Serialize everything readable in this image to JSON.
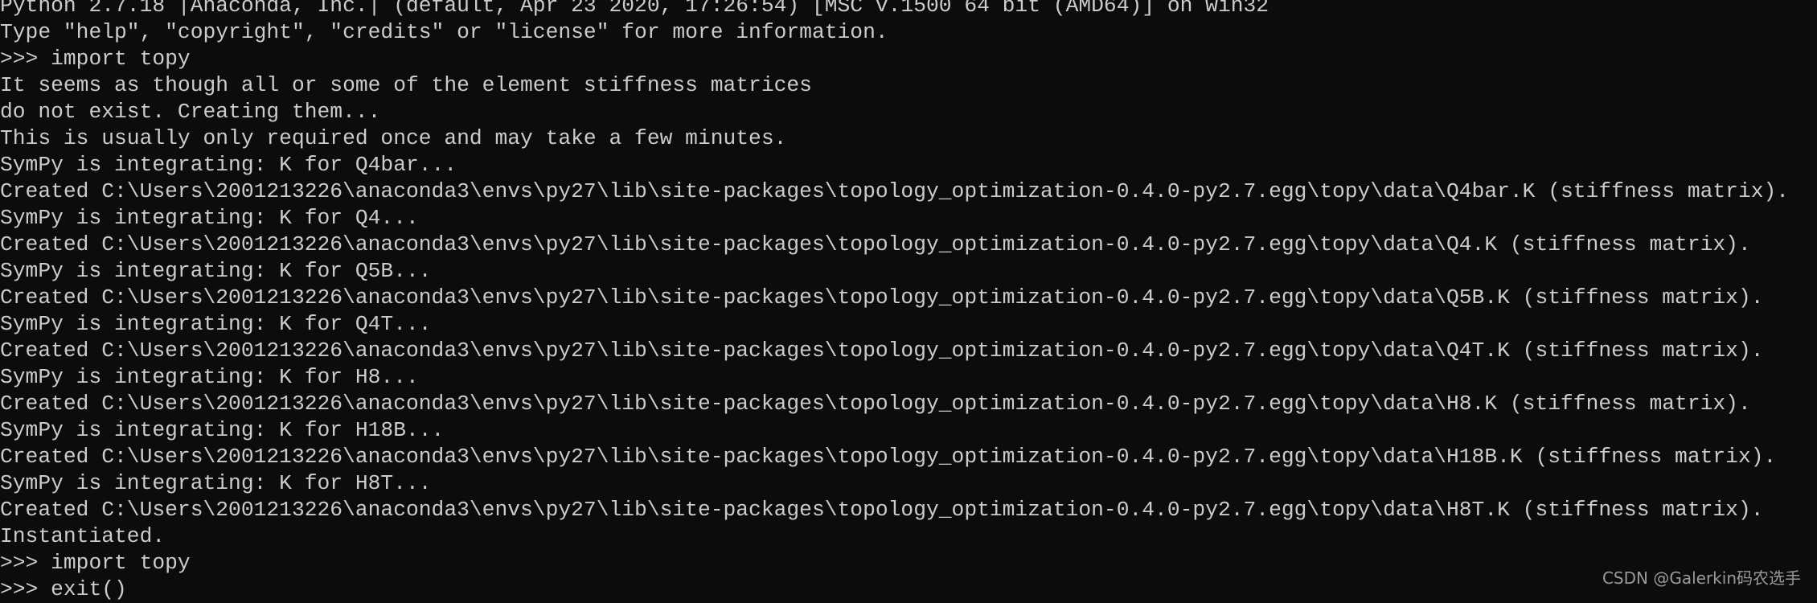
{
  "console": {
    "background": "#0c0c0c",
    "foreground": "#cccccc",
    "lines": [
      "Python 2.7.18 |Anaconda, Inc.| (default, Apr 23 2020, 17:26:54) [MSC v.1500 64 bit (AMD64)] on win32",
      "Type \"help\", \"copyright\", \"credits\" or \"license\" for more information.",
      ">>> import topy",
      "It seems as though all or some of the element stiffness matrices",
      "do not exist. Creating them...",
      "This is usually only required once and may take a few minutes.",
      "SymPy is integrating: K for Q4bar...",
      "Created C:\\Users\\2001213226\\anaconda3\\envs\\py27\\lib\\site-packages\\topology_optimization-0.4.0-py2.7.egg\\topy\\data\\Q4bar.K (stiffness matrix).",
      "SymPy is integrating: K for Q4...",
      "Created C:\\Users\\2001213226\\anaconda3\\envs\\py27\\lib\\site-packages\\topology_optimization-0.4.0-py2.7.egg\\topy\\data\\Q4.K (stiffness matrix).",
      "SymPy is integrating: K for Q5B...",
      "Created C:\\Users\\2001213226\\anaconda3\\envs\\py27\\lib\\site-packages\\topology_optimization-0.4.0-py2.7.egg\\topy\\data\\Q5B.K (stiffness matrix).",
      "SymPy is integrating: K for Q4T...",
      "Created C:\\Users\\2001213226\\anaconda3\\envs\\py27\\lib\\site-packages\\topology_optimization-0.4.0-py2.7.egg\\topy\\data\\Q4T.K (stiffness matrix).",
      "SymPy is integrating: K for H8...",
      "Created C:\\Users\\2001213226\\anaconda3\\envs\\py27\\lib\\site-packages\\topology_optimization-0.4.0-py2.7.egg\\topy\\data\\H8.K (stiffness matrix).",
      "SymPy is integrating: K for H18B...",
      "Created C:\\Users\\2001213226\\anaconda3\\envs\\py27\\lib\\site-packages\\topology_optimization-0.4.0-py2.7.egg\\topy\\data\\H18B.K (stiffness matrix).",
      "SymPy is integrating: K for H8T...",
      "Created C:\\Users\\2001213226\\anaconda3\\envs\\py27\\lib\\site-packages\\topology_optimization-0.4.0-py2.7.egg\\topy\\data\\H8T.K (stiffness matrix).",
      "Instantiated.",
      ">>> import topy",
      ">>> exit()"
    ]
  },
  "watermark": "CSDN @Galerkin码农选手"
}
